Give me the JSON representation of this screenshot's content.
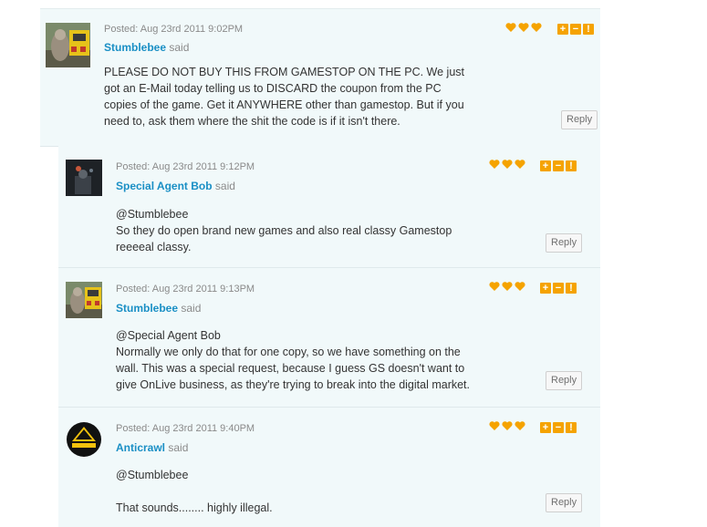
{
  "comments": [
    {
      "posted": "Posted: Aug 23rd 2011 9:02PM",
      "author": "Stumblebee",
      "said": "said",
      "lines": [
        "PLEASE DO NOT BUY THIS FROM GAMESTOP ON THE PC. We just",
        "got an E-Mail today telling us to DISCARD the coupon from the PC",
        "copies of the game. Get it ANYWHERE other than gamestop. But if you",
        "need to, ask them where the shit the code is if it isn't there."
      ],
      "reply_label": "Reply"
    },
    {
      "posted": "Posted: Aug 23rd 2011 9:12PM",
      "author": "Special Agent Bob",
      "said": "said",
      "lines": [
        "@Stumblebee",
        "So they do open brand new games and also real classy Gamestop",
        "reeeeal classy."
      ],
      "reply_label": "Reply"
    },
    {
      "posted": "Posted: Aug 23rd 2011 9:13PM",
      "author": "Stumblebee",
      "said": "said",
      "lines": [
        "@Special Agent Bob",
        "Normally we only do that for one copy, so we have something on the",
        "wall. This was a special request, because I guess GS doesn't want to",
        "give OnLive business, as they're trying to break into the digital market."
      ],
      "reply_label": "Reply"
    },
    {
      "posted": "Posted: Aug 23rd 2011 9:40PM",
      "author": "Anticrawl",
      "said": "said",
      "lines": [
        "@Stumblebee",
        "",
        "That sounds........ highly illegal."
      ],
      "reply_label": "Reply"
    }
  ],
  "actions": {
    "plus": "+",
    "minus": "−",
    "flag": "!"
  },
  "colors": {
    "accent": "#f5a300",
    "link": "#1a8fc5",
    "background": "#f1f9fa"
  },
  "icons": {
    "heart": "heart-icon",
    "plus": "plus-icon",
    "minus": "minus-icon",
    "flag": "flag-icon"
  }
}
